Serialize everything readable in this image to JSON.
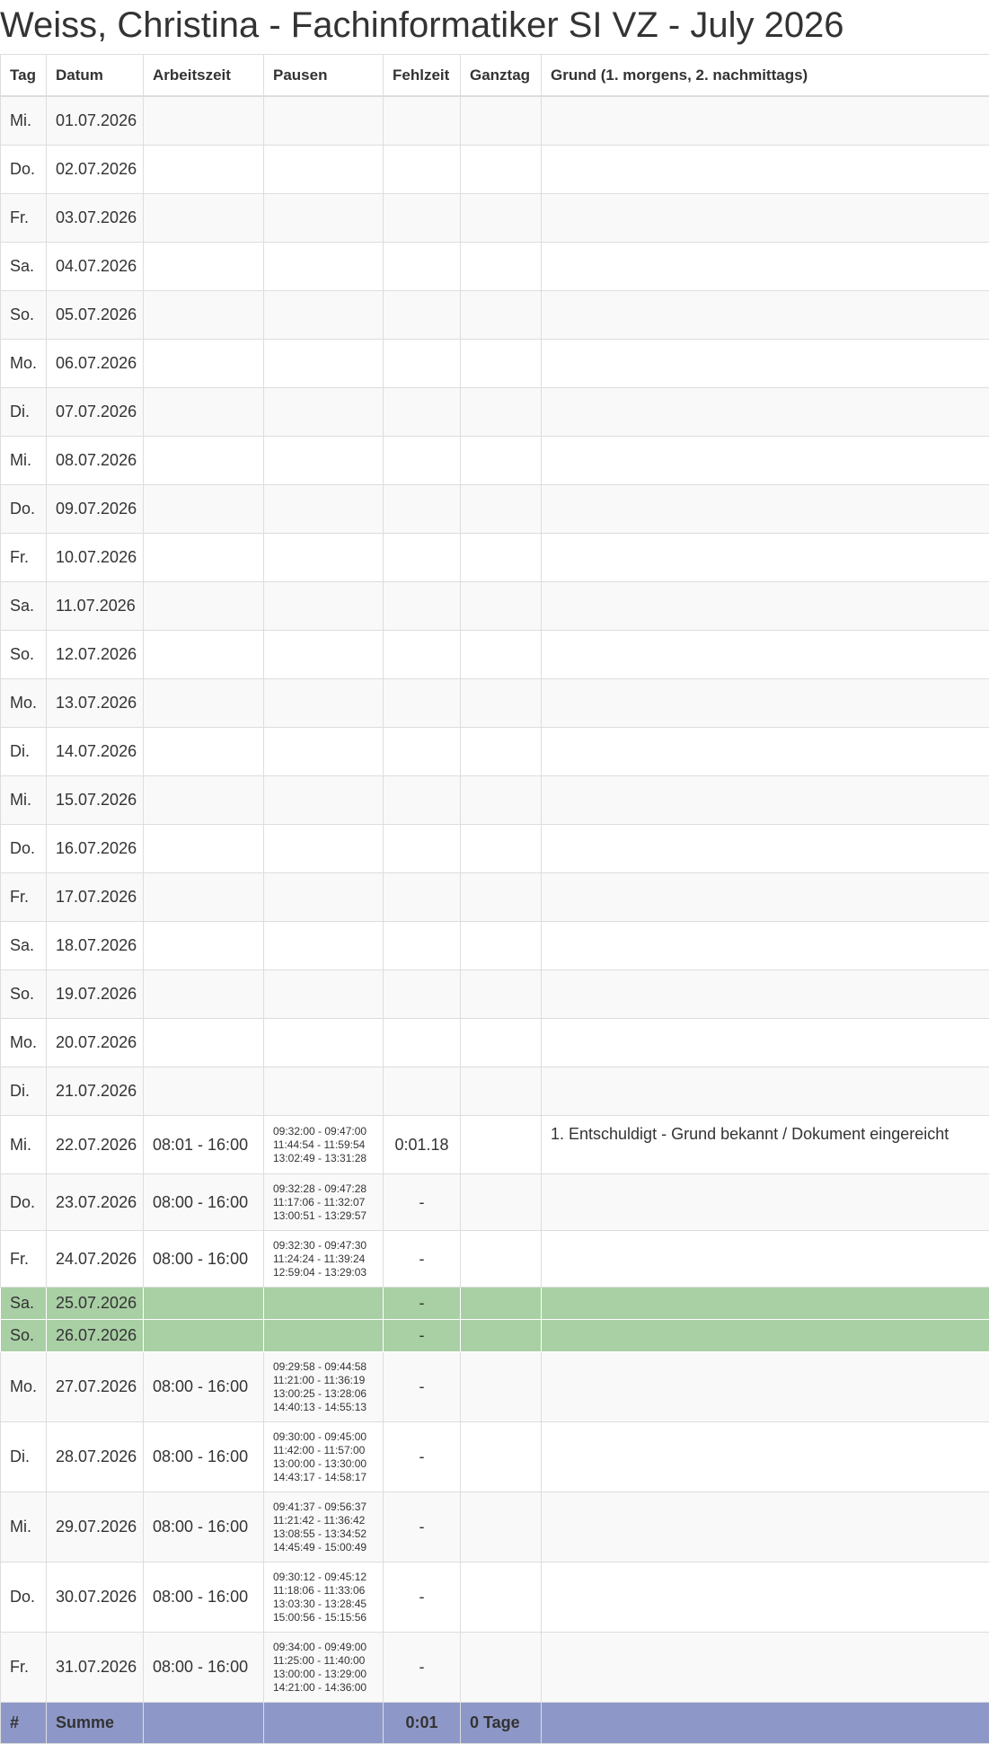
{
  "title": "Weiss, Christina - Fachinformatiker SI VZ - July 2026",
  "headers": {
    "tag": "Tag",
    "datum": "Datum",
    "arbeitszeit": "Arbeitszeit",
    "pausen": "Pausen",
    "fehlzeit": "Fehlzeit",
    "ganztag": "Ganztag",
    "grund": "Grund (1. morgens, 2. nachmittags)"
  },
  "rows": [
    {
      "tag": "Mi.",
      "datum": "01.07.2026",
      "arbeitszeit": "",
      "pausen": [],
      "fehlzeit": "",
      "ganztag": "",
      "grund": ""
    },
    {
      "tag": "Do.",
      "datum": "02.07.2026",
      "arbeitszeit": "",
      "pausen": [],
      "fehlzeit": "",
      "ganztag": "",
      "grund": ""
    },
    {
      "tag": "Fr.",
      "datum": "03.07.2026",
      "arbeitszeit": "",
      "pausen": [],
      "fehlzeit": "",
      "ganztag": "",
      "grund": ""
    },
    {
      "tag": "Sa.",
      "datum": "04.07.2026",
      "arbeitszeit": "",
      "pausen": [],
      "fehlzeit": "",
      "ganztag": "",
      "grund": ""
    },
    {
      "tag": "So.",
      "datum": "05.07.2026",
      "arbeitszeit": "",
      "pausen": [],
      "fehlzeit": "",
      "ganztag": "",
      "grund": ""
    },
    {
      "tag": "Mo.",
      "datum": "06.07.2026",
      "arbeitszeit": "",
      "pausen": [],
      "fehlzeit": "",
      "ganztag": "",
      "grund": ""
    },
    {
      "tag": "Di.",
      "datum": "07.07.2026",
      "arbeitszeit": "",
      "pausen": [],
      "fehlzeit": "",
      "ganztag": "",
      "grund": ""
    },
    {
      "tag": "Mi.",
      "datum": "08.07.2026",
      "arbeitszeit": "",
      "pausen": [],
      "fehlzeit": "",
      "ganztag": "",
      "grund": ""
    },
    {
      "tag": "Do.",
      "datum": "09.07.2026",
      "arbeitszeit": "",
      "pausen": [],
      "fehlzeit": "",
      "ganztag": "",
      "grund": ""
    },
    {
      "tag": "Fr.",
      "datum": "10.07.2026",
      "arbeitszeit": "",
      "pausen": [],
      "fehlzeit": "",
      "ganztag": "",
      "grund": ""
    },
    {
      "tag": "Sa.",
      "datum": "11.07.2026",
      "arbeitszeit": "",
      "pausen": [],
      "fehlzeit": "",
      "ganztag": "",
      "grund": ""
    },
    {
      "tag": "So.",
      "datum": "12.07.2026",
      "arbeitszeit": "",
      "pausen": [],
      "fehlzeit": "",
      "ganztag": "",
      "grund": ""
    },
    {
      "tag": "Mo.",
      "datum": "13.07.2026",
      "arbeitszeit": "",
      "pausen": [],
      "fehlzeit": "",
      "ganztag": "",
      "grund": ""
    },
    {
      "tag": "Di.",
      "datum": "14.07.2026",
      "arbeitszeit": "",
      "pausen": [],
      "fehlzeit": "",
      "ganztag": "",
      "grund": ""
    },
    {
      "tag": "Mi.",
      "datum": "15.07.2026",
      "arbeitszeit": "",
      "pausen": [],
      "fehlzeit": "",
      "ganztag": "",
      "grund": ""
    },
    {
      "tag": "Do.",
      "datum": "16.07.2026",
      "arbeitszeit": "",
      "pausen": [],
      "fehlzeit": "",
      "ganztag": "",
      "grund": ""
    },
    {
      "tag": "Fr.",
      "datum": "17.07.2026",
      "arbeitszeit": "",
      "pausen": [],
      "fehlzeit": "",
      "ganztag": "",
      "grund": ""
    },
    {
      "tag": "Sa.",
      "datum": "18.07.2026",
      "arbeitszeit": "",
      "pausen": [],
      "fehlzeit": "",
      "ganztag": "",
      "grund": ""
    },
    {
      "tag": "So.",
      "datum": "19.07.2026",
      "arbeitszeit": "",
      "pausen": [],
      "fehlzeit": "",
      "ganztag": "",
      "grund": ""
    },
    {
      "tag": "Mo.",
      "datum": "20.07.2026",
      "arbeitszeit": "",
      "pausen": [],
      "fehlzeit": "",
      "ganztag": "",
      "grund": ""
    },
    {
      "tag": "Di.",
      "datum": "21.07.2026",
      "arbeitszeit": "",
      "pausen": [],
      "fehlzeit": "",
      "ganztag": "",
      "grund": ""
    },
    {
      "tag": "Mi.",
      "datum": "22.07.2026",
      "arbeitszeit": "08:01 - 16:00",
      "pausen": [
        "09:32:00 - 09:47:00",
        "11:44:54 - 11:59:54",
        "13:02:49 - 13:31:28"
      ],
      "fehlzeit": "0:01.18",
      "ganztag": "",
      "grund": "1. Entschuldigt - Grund bekannt / Dokument eingereicht"
    },
    {
      "tag": "Do.",
      "datum": "23.07.2026",
      "arbeitszeit": "08:00 - 16:00",
      "pausen": [
        "09:32:28 - 09:47:28",
        "11:17:06 - 11:32:07",
        "13:00:51 - 13:29:57"
      ],
      "fehlzeit": "-",
      "ganztag": "",
      "grund": ""
    },
    {
      "tag": "Fr.",
      "datum": "24.07.2026",
      "arbeitszeit": "08:00 - 16:00",
      "pausen": [
        "09:32:30 - 09:47:30",
        "11:24:24 - 11:39:24",
        "12:59:04 - 13:29:03"
      ],
      "fehlzeit": "-",
      "ganztag": "",
      "grund": ""
    },
    {
      "tag": "Sa.",
      "datum": "25.07.2026",
      "arbeitszeit": "",
      "pausen": [],
      "fehlzeit": "-",
      "ganztag": "",
      "grund": "",
      "weekend": true
    },
    {
      "tag": "So.",
      "datum": "26.07.2026",
      "arbeitszeit": "",
      "pausen": [],
      "fehlzeit": "-",
      "ganztag": "",
      "grund": "",
      "weekend": true
    },
    {
      "tag": "Mo.",
      "datum": "27.07.2026",
      "arbeitszeit": "08:00 - 16:00",
      "pausen": [
        "09:29:58 - 09:44:58",
        "11:21:00 - 11:36:19",
        "13:00:25 - 13:28:06",
        "14:40:13 - 14:55:13"
      ],
      "fehlzeit": "-",
      "ganztag": "",
      "grund": ""
    },
    {
      "tag": "Di.",
      "datum": "28.07.2026",
      "arbeitszeit": "08:00 - 16:00",
      "pausen": [
        "09:30:00 - 09:45:00",
        "11:42:00 - 11:57:00",
        "13:00:00 - 13:30:00",
        "14:43:17 - 14:58:17"
      ],
      "fehlzeit": "-",
      "ganztag": "",
      "grund": ""
    },
    {
      "tag": "Mi.",
      "datum": "29.07.2026",
      "arbeitszeit": "08:00 - 16:00",
      "pausen": [
        "09:41:37 - 09:56:37",
        "11:21:42 - 11:36:42",
        "13:08:55 - 13:34:52",
        "14:45:49 - 15:00:49"
      ],
      "fehlzeit": "-",
      "ganztag": "",
      "grund": ""
    },
    {
      "tag": "Do.",
      "datum": "30.07.2026",
      "arbeitszeit": "08:00 - 16:00",
      "pausen": [
        "09:30:12 - 09:45:12",
        "11:18:06 - 11:33:06",
        "13:03:30 - 13:28:45",
        "15:00:56 - 15:15:56"
      ],
      "fehlzeit": "-",
      "ganztag": "",
      "grund": ""
    },
    {
      "tag": "Fr.",
      "datum": "31.07.2026",
      "arbeitszeit": "08:00 - 16:00",
      "pausen": [
        "09:34:00 - 09:49:00",
        "11:25:00 - 11:40:00",
        "13:00:00 - 13:29:00",
        "14:21:00 - 14:36:00"
      ],
      "fehlzeit": "-",
      "ganztag": "",
      "grund": ""
    }
  ],
  "footer": {
    "hash": "#",
    "summe": "Summe",
    "fehlzeit_total": "0:01",
    "ganztag_total": "0 Tage"
  },
  "colors": {
    "weekend": "#a9cfa5",
    "footer": "#8e98c8",
    "stripe": "#f9f9f9"
  }
}
